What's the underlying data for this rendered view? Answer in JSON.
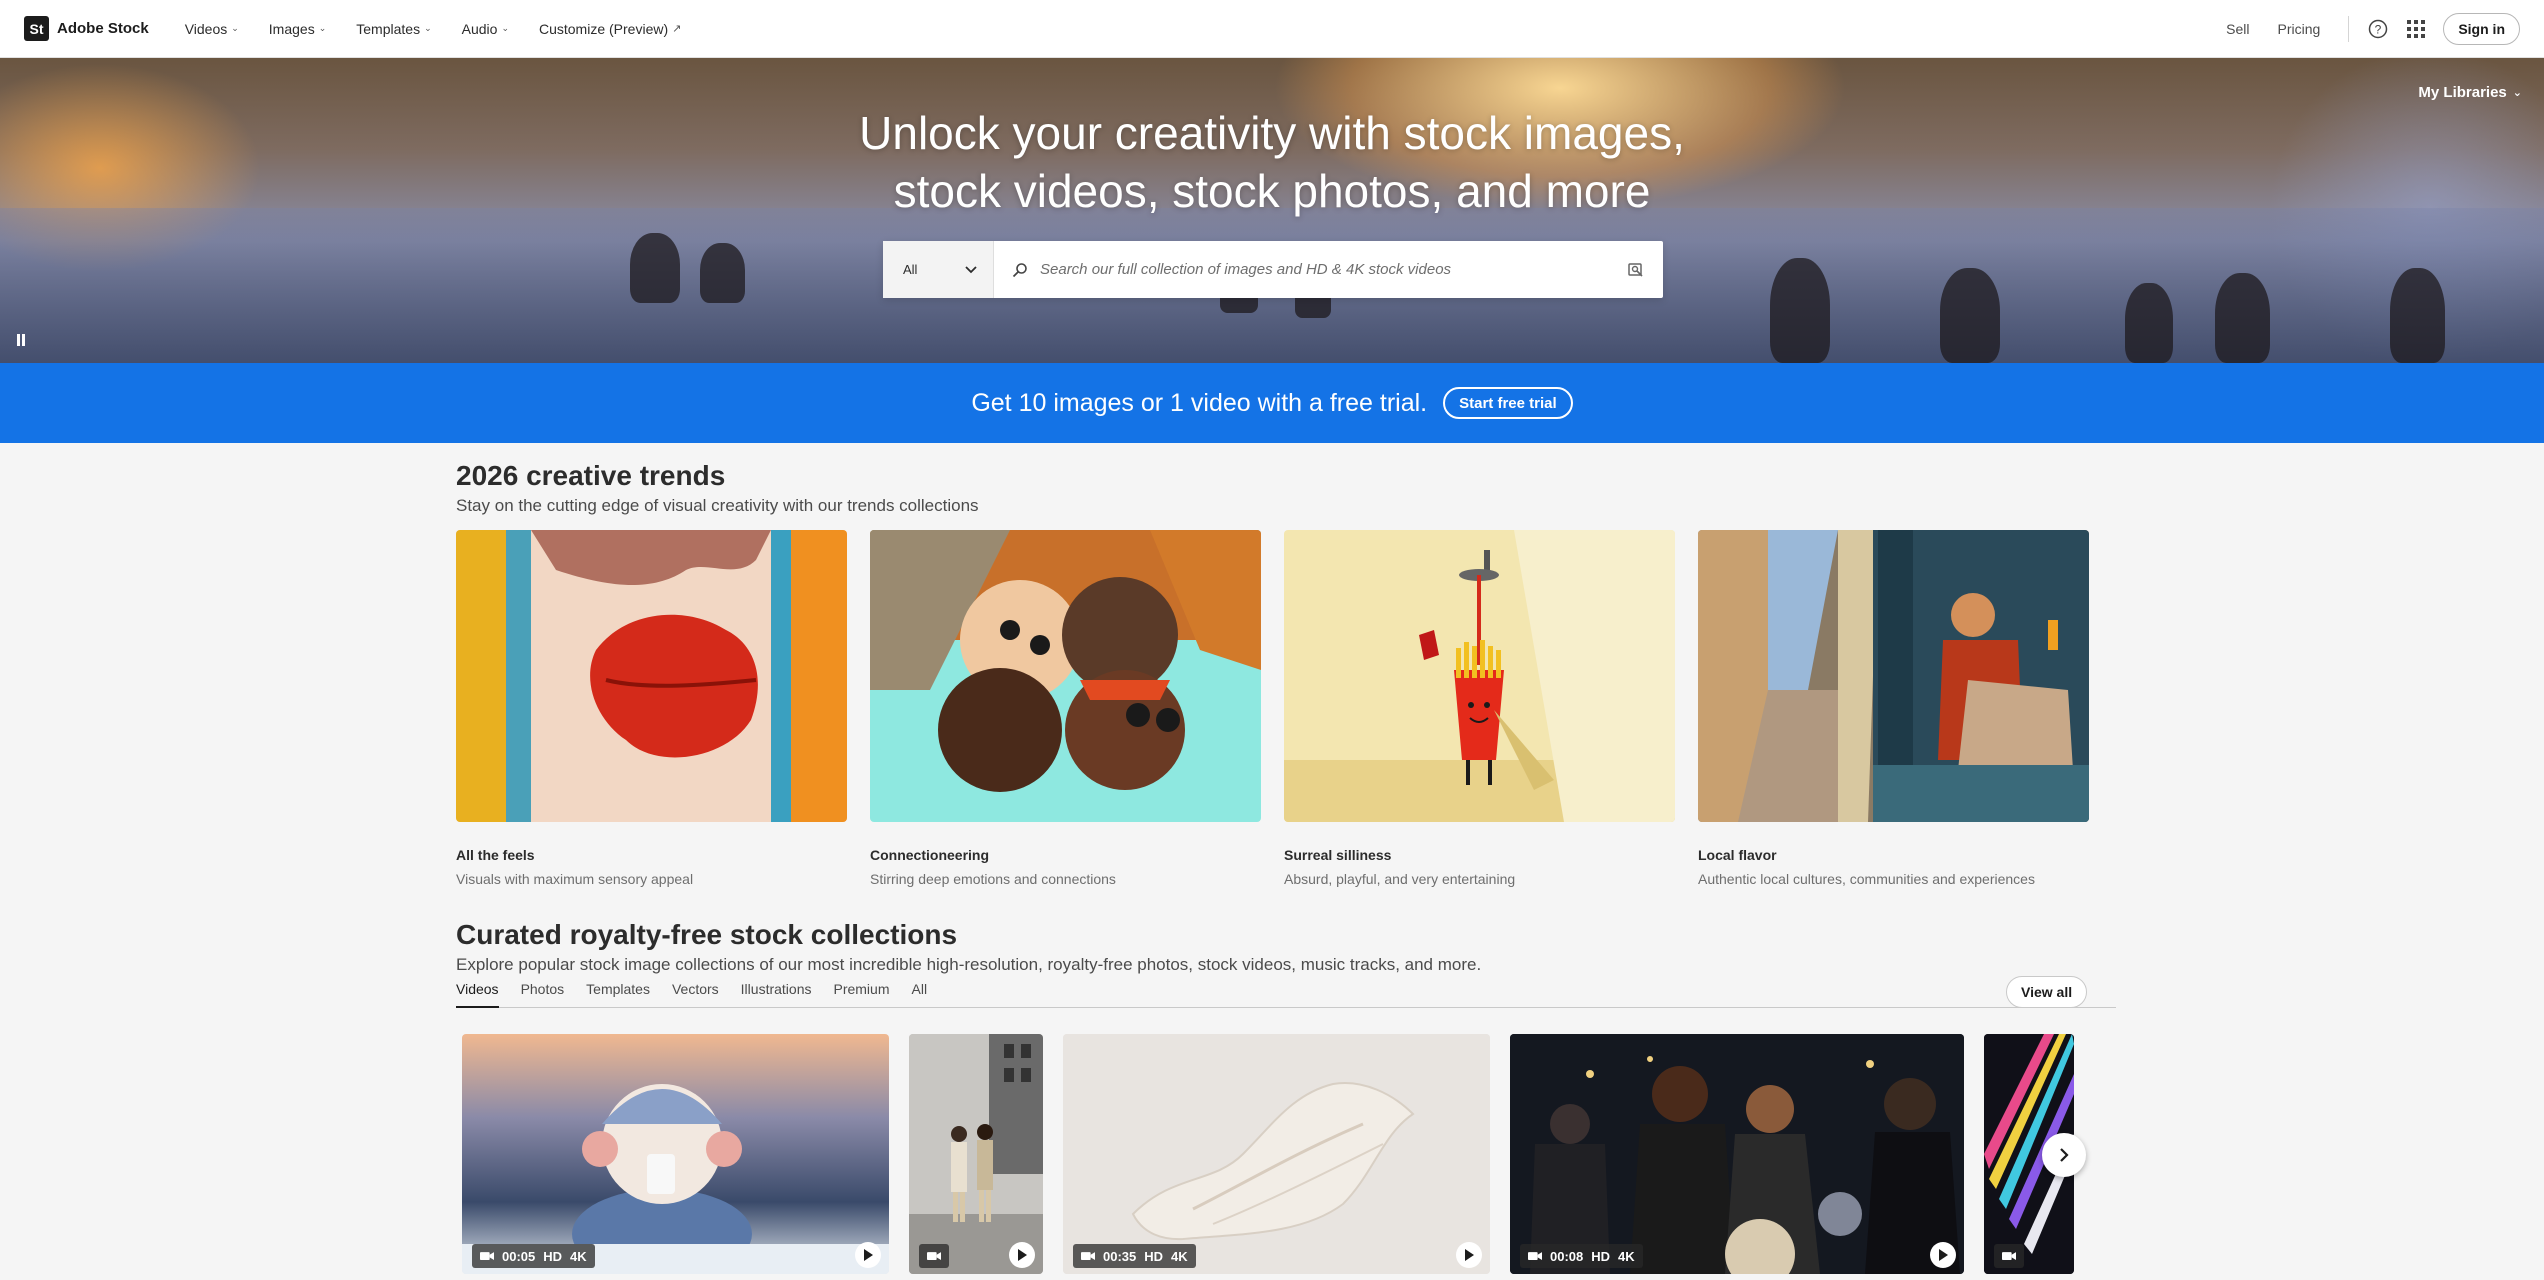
{
  "brand": {
    "logo_text": "St",
    "name": "Adobe Stock"
  },
  "nav": {
    "items": [
      {
        "label": "Videos"
      },
      {
        "label": "Images"
      },
      {
        "label": "Templates"
      },
      {
        "label": "Audio"
      }
    ],
    "customize": "Customize (Preview)",
    "sell": "Sell",
    "pricing": "Pricing",
    "signin": "Sign in"
  },
  "hero": {
    "title_line1": "Unlock your creativity with stock images,",
    "title_line2": "stock videos, stock photos, and more",
    "my_libraries": "My Libraries",
    "search": {
      "type_value": "All",
      "placeholder": "Search our full collection of images and HD & 4K stock videos"
    }
  },
  "promo": {
    "text": "Get 10 images or 1 video with a free trial.",
    "button": "Start free trial"
  },
  "trends": {
    "title": "2026 creative trends",
    "subtitle": "Stay on the cutting edge of visual creativity with our trends collections",
    "cards": [
      {
        "name": "All the feels",
        "desc": "Visuals with maximum sensory appeal"
      },
      {
        "name": "Connectioneering",
        "desc": "Stirring deep emotions and connections"
      },
      {
        "name": "Surreal silliness",
        "desc": "Absurd, playful, and very entertaining"
      },
      {
        "name": "Local flavor",
        "desc": "Authentic local cultures, communities and experiences"
      }
    ]
  },
  "collections": {
    "title": "Curated royalty-free stock collections",
    "subtitle": "Explore popular stock image collections of our most incredible high-resolution, royalty-free photos, stock videos, music tracks, and more.",
    "tabs": [
      "Videos",
      "Photos",
      "Templates",
      "Vectors",
      "Illustrations",
      "Premium",
      "All"
    ],
    "active_tab": "Videos",
    "view_all": "View all",
    "videos": [
      {
        "duration": "00:05",
        "hd": "HD",
        "res": "4K"
      },
      {
        "duration": "",
        "hd": "",
        "res": ""
      },
      {
        "duration": "00:35",
        "hd": "HD",
        "res": "4K"
      },
      {
        "duration": "00:08",
        "hd": "HD",
        "res": "4K"
      },
      {
        "duration": "",
        "hd": "",
        "res": ""
      }
    ]
  },
  "colors": {
    "accent_blue": "#1473e6",
    "text": "#2c2c2c"
  }
}
